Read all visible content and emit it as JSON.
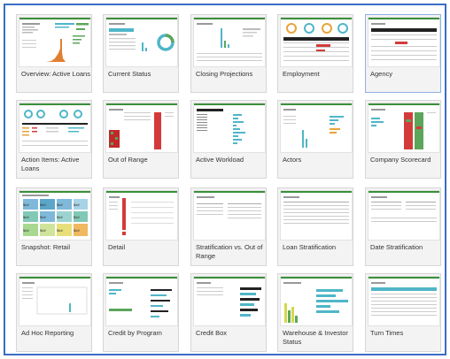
{
  "sheets": [
    {
      "id": "overview",
      "label": "Overview: Active Loans",
      "thumb": "overview"
    },
    {
      "id": "current-status",
      "label": "Current Status",
      "thumb": "donut"
    },
    {
      "id": "closing-projections",
      "label": "Closing Projections",
      "thumb": "closing"
    },
    {
      "id": "employment",
      "label": "Employment",
      "thumb": "employment"
    },
    {
      "id": "agency",
      "label": "Agency",
      "thumb": "agency"
    },
    {
      "id": "action-items",
      "label": "Action Items: Active Loans",
      "thumb": "action"
    },
    {
      "id": "out-of-range",
      "label": "Out of Range",
      "thumb": "outofrange"
    },
    {
      "id": "active-workload",
      "label": "Active Workload",
      "thumb": "workload"
    },
    {
      "id": "actors",
      "label": "Actors",
      "thumb": "actors"
    },
    {
      "id": "company-scorecard",
      "label": "Company Scorecard",
      "thumb": "scorecard"
    },
    {
      "id": "snapshot-retail",
      "label": "Snapshot: Retail",
      "thumb": "snapshot"
    },
    {
      "id": "detail",
      "label": "Detail",
      "thumb": "detail"
    },
    {
      "id": "stratification-oor",
      "label": "Stratification vs. Out of Range",
      "thumb": "table"
    },
    {
      "id": "loan-stratification",
      "label": "Loan Stratification",
      "thumb": "table2"
    },
    {
      "id": "date-stratification",
      "label": "Date Stratification",
      "thumb": "table3"
    },
    {
      "id": "ad-hoc-reporting",
      "label": "Ad Hoc Reporting",
      "thumb": "adhoc"
    },
    {
      "id": "credit-by-program",
      "label": "Credit by Program",
      "thumb": "credit"
    },
    {
      "id": "credit-box",
      "label": "Credit Box",
      "thumb": "creditbox"
    },
    {
      "id": "warehouse-investor",
      "label": "Warehouse & Investor Status",
      "thumb": "warehouse"
    },
    {
      "id": "turn-times",
      "label": "Turn Times",
      "thumb": "turntimes"
    }
  ],
  "snapshot_tiles": [
    "$##",
    "$##",
    "$##",
    "$##",
    "$##",
    "$##",
    "$##",
    "$##",
    "$##",
    "$##",
    "$##",
    "$##"
  ],
  "colors": {
    "selection_border": "#3b6cc4",
    "header_bar": "#3a8f3a",
    "teal": "#4fb6c8",
    "red": "#d33b3b",
    "yellow": "#e9c84a",
    "green": "#5ba65b"
  }
}
